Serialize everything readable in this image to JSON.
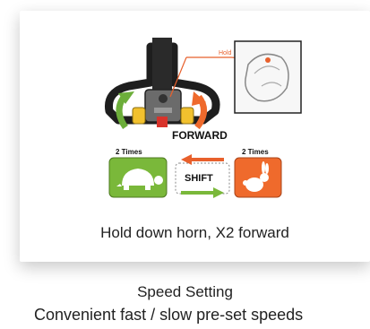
{
  "card": {
    "hold_tag": "Hold",
    "direction_label": "FORWARD",
    "left_times": "2 Times",
    "right_times": "2 Times",
    "shift_label": "SHIFT",
    "caption": "Hold down horn, X2 forward",
    "slow_mode_icon": "turtle-icon",
    "fast_mode_icon": "rabbit-icon",
    "colors": {
      "slow": "#7ab83a",
      "fast": "#ef6a2c",
      "hold_line": "#e8602c"
    }
  },
  "figure": {
    "title": "Speed Setting",
    "subtitle": "Convenient fast / slow pre-set speeds"
  }
}
